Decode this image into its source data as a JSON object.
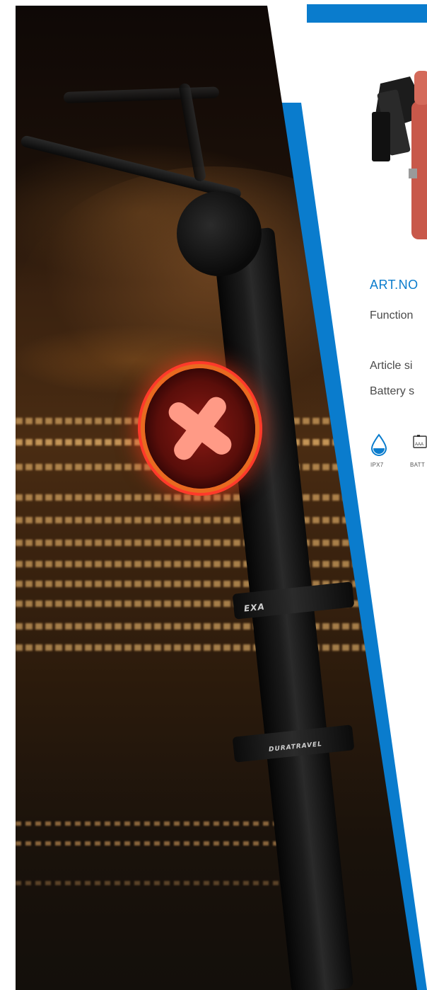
{
  "colors": {
    "accent": "#0a7ccd",
    "body_text": "#4a4a4a"
  },
  "photo": {
    "seatpost_band_1": "EXA",
    "seatpost_band_2": "DURATRAVEL"
  },
  "product": {
    "art_no": "ART.NO",
    "specs": {
      "function": "Function",
      "article_size": "Article si",
      "battery": "Battery s"
    },
    "icons": [
      {
        "name": "water-drop-icon",
        "label": "IPX7"
      },
      {
        "name": "battery-icon",
        "label": "BATT",
        "glyph_text": "AAA"
      }
    ]
  }
}
